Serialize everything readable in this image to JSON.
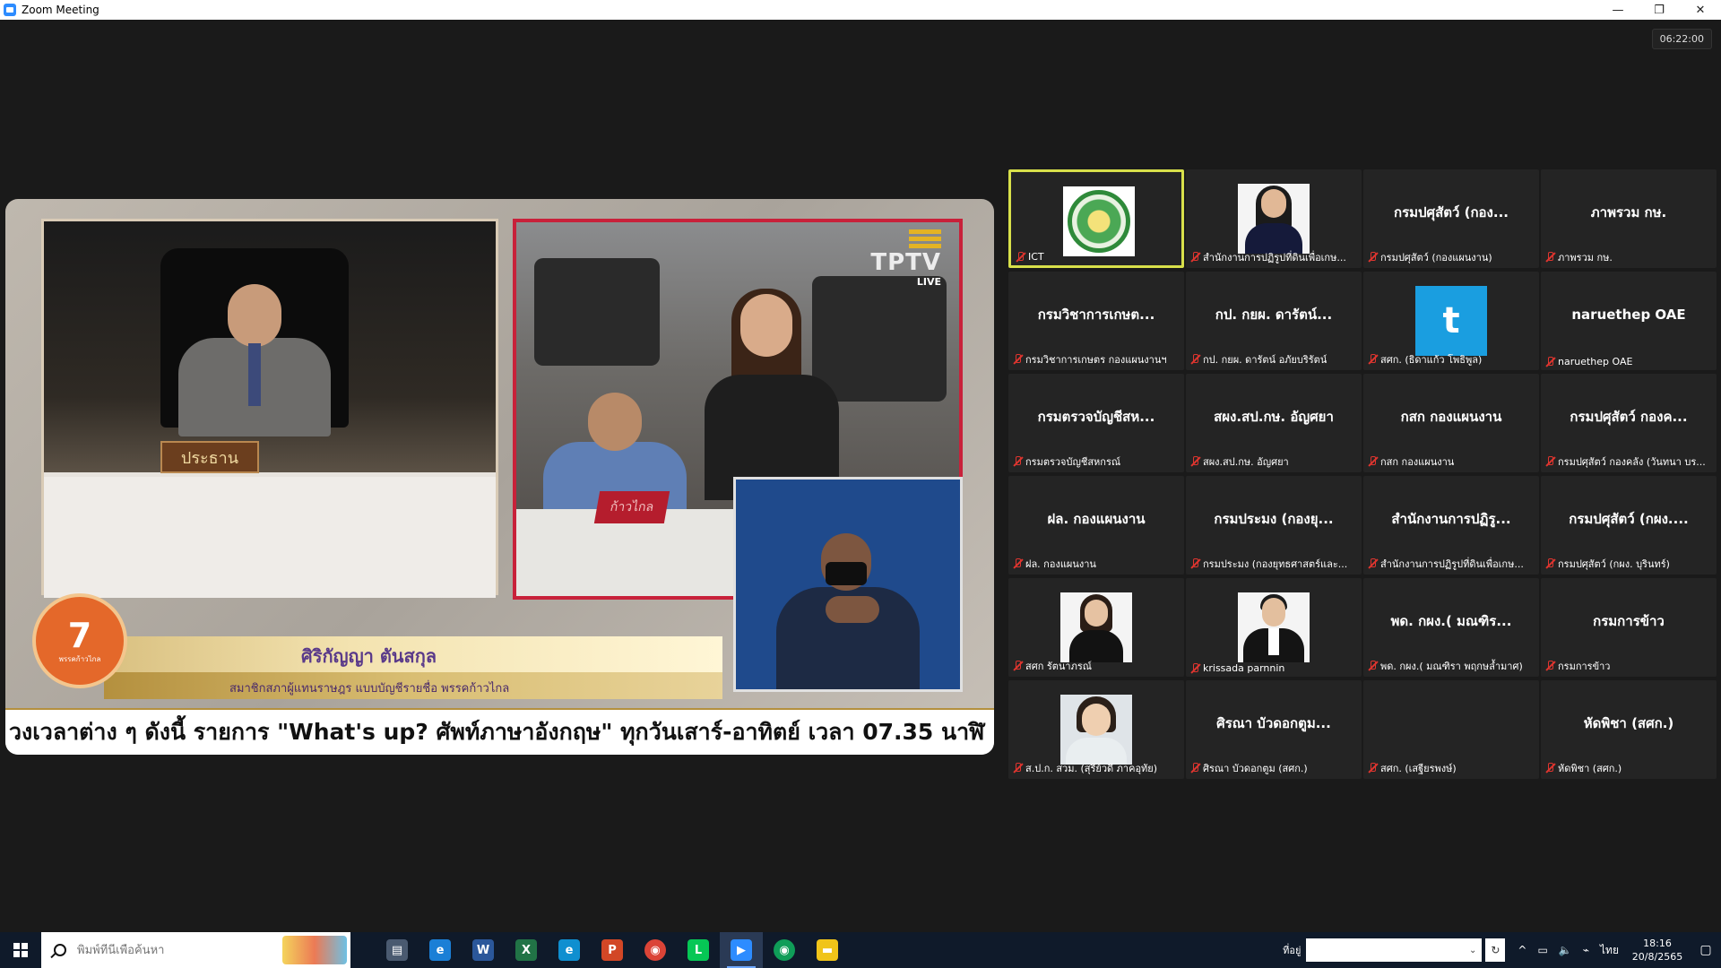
{
  "window": {
    "title": "Zoom Meeting",
    "minimize": "—",
    "restore": "❐",
    "close": "✕"
  },
  "meeting": {
    "timer": "06:22:00"
  },
  "share": {
    "left_nameplate": "ประธาน",
    "right_nameplate": "ก้าวไกล",
    "tptv_logo": "TPTV",
    "tptv_live": "LIVE",
    "speaker_name": "ศิริกัญญา ตันสกุล",
    "speaker_role": "สมาชิกสภาผู้แทนราษฎร แบบบัญชีรายชื่อ พรรคก้าวไกล",
    "party_logo_text": "พรรคก้าวไกล",
    "ticker": "วงเวลาต่าง ๆ ดังนี้ รายการ \"What's up? ศัพท์ภาษาอังกฤษ\" ทุกวันเสาร์-อาทิตย์ เวลา 07.35 นาฬิ"
  },
  "gallery": {
    "tiles": [
      {
        "big": "",
        "label": "ICT",
        "photo": "emblem",
        "active": true
      },
      {
        "big": "",
        "label": "สำนักงานการปฏิรูปที่ดินเพื่อเกษ...",
        "photo": "woman1"
      },
      {
        "big": "กรมปศุสัตว์ (กอง...",
        "label": "กรมปศุสัตว์ (กองแผนงาน)"
      },
      {
        "big": "ภาพรวม กษ.",
        "label": "ภาพรวม กษ."
      },
      {
        "big": "กรมวิชาการเกษต...",
        "label": "กรมวิชาการเกษตร กองแผนงานฯ"
      },
      {
        "big": "กป. กยผ. ดารัตน์...",
        "label": "กป. กยผ. ดารัตน์ อภัยบริรัตน์"
      },
      {
        "big": "",
        "label": "สศก. (ธิดาแก้ว โพธิพูล)",
        "photo": "t",
        "photo_text": "t"
      },
      {
        "big": "naruethep OAE",
        "label": "naruethep OAE"
      },
      {
        "big": "กรมตรวจบัญชีสห...",
        "label": "กรมตรวจบัญชีสหกรณ์"
      },
      {
        "big": "สผง.สป.กษ. อัญศยา",
        "label": "สผง.สป.กษ. อัญศยา"
      },
      {
        "big": "กสก กองแผนงาน",
        "label": "กสก กองแผนงาน"
      },
      {
        "big": "กรมปศุสัตว์ กองค...",
        "label": "กรมปศุสัตว์ กองคลัง (วันทนา บร..."
      },
      {
        "big": "ฝล. กองแผนงาน",
        "label": "ฝล. กองแผนงาน"
      },
      {
        "big": "กรมประมง (กองยุ...",
        "label": "กรมประมง (กองยุทธศาสตร์และ..."
      },
      {
        "big": "สำนักงานการปฏิรู...",
        "label": "สำนักงานการปฏิรูปที่ดินเพื่อเกษ..."
      },
      {
        "big": "กรมปศุสัตว์ (กผง....",
        "label": "กรมปศุสัตว์ (กผง. บุรินทร์)"
      },
      {
        "big": "",
        "label": "สศก รัตนาภรณ์",
        "photo": "woman2"
      },
      {
        "big": "",
        "label": "krissada parnnin",
        "photo": "man"
      },
      {
        "big": "พด. กผง.( มณฑิร...",
        "label": "พด. กผง.( มณฑิรา พฤกษล้ำมาศ)"
      },
      {
        "big": "กรมการข้าว",
        "label": "กรมการข้าว"
      },
      {
        "big": "",
        "label": "ส.ป.ก. สวม. (สุรีย์วดี ภาคอุทัย)",
        "photo": "woman3"
      },
      {
        "big": "ศิรณา บัวดอกตูม...",
        "label": "ศิรณา บัวดอกตูม (สศก.)"
      },
      {
        "big": "",
        "label": "สศก. (เสฐียรพงษ์)"
      },
      {
        "big": "หัดพิชา (สศก.)",
        "label": "หัดพิชา (สศก.)"
      }
    ]
  },
  "taskbar": {
    "search_placeholder": "พิมพ์ที่นี่เพื่อค้นหา",
    "apps": [
      {
        "name": "task-view",
        "glyph": "▤",
        "color": "#4a5a70"
      },
      {
        "name": "internet-explorer",
        "glyph": "e",
        "color": "#1b7fd6"
      },
      {
        "name": "word",
        "glyph": "W",
        "color": "#2b579a"
      },
      {
        "name": "excel",
        "glyph": "X",
        "color": "#217346"
      },
      {
        "name": "edge",
        "glyph": "e",
        "color": "#0f8fd0"
      },
      {
        "name": "powerpoint",
        "glyph": "P",
        "color": "#d24726"
      },
      {
        "name": "chrome",
        "glyph": "◉",
        "color": "#db4437"
      },
      {
        "name": "line",
        "glyph": "L",
        "color": "#06c755"
      },
      {
        "name": "zoom",
        "glyph": "▶",
        "color": "#2d8cff",
        "active": true
      },
      {
        "name": "chrome-2",
        "glyph": "◉",
        "color": "#0f9d58"
      },
      {
        "name": "file-explorer",
        "glyph": "▬",
        "color": "#f0c419"
      }
    ],
    "location_label": "ที่อยู่",
    "address_dropdown": "⌄",
    "refresh": "↻",
    "tray_arrow": "^",
    "tray_icons": [
      "▭",
      "🔈",
      "⌁"
    ],
    "language": "ไทย",
    "time": "18:16",
    "date": "20/8/2565",
    "notification": "▢"
  }
}
